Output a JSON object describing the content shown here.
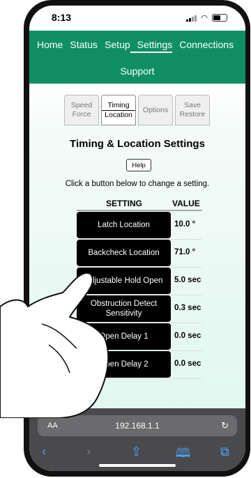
{
  "status": {
    "time": "8:13"
  },
  "nav": {
    "items": [
      "Home",
      "Status",
      "Setup",
      "Settings",
      "Connections"
    ],
    "active": "Settings",
    "support": "Support"
  },
  "tabs": [
    {
      "line1": "Speed",
      "line2": "Force"
    },
    {
      "line1": "Timing",
      "line2": "Location"
    },
    {
      "line1": "Options",
      "line2": ""
    },
    {
      "line1": "Save",
      "line2": "Restore"
    }
  ],
  "page": {
    "title": "Timing & Location Settings",
    "help": "Help",
    "instruction": "Click a button below to change a setting.",
    "col_setting": "SETTING",
    "col_value": "VALUE"
  },
  "settings": [
    {
      "label": "Latch Location",
      "value": "10.0 °"
    },
    {
      "label": "Backcheck Location",
      "value": "71.0 °"
    },
    {
      "label": "Adjustable Hold Open",
      "value": "5.0 sec"
    },
    {
      "label": "Obstruction Detect Sensitivity",
      "value": "0.3 sec"
    },
    {
      "label": "Open Delay 1",
      "value": "0.0 sec"
    },
    {
      "label": "Open Delay 2",
      "value": "0.0 sec"
    }
  ],
  "browser": {
    "aa": "AA",
    "url": "192.168.1.1",
    "icons": [
      "back-icon",
      "forward-icon",
      "share-icon",
      "bookmarks-icon",
      "tabs-icon"
    ]
  }
}
